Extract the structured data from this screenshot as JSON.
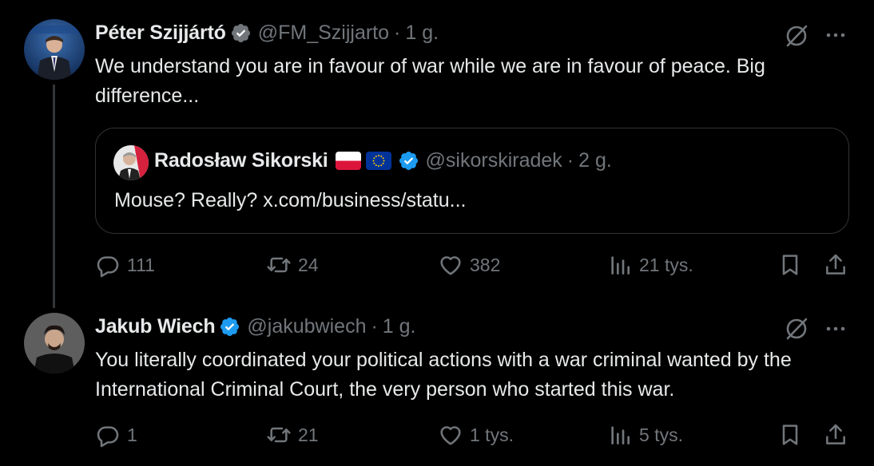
{
  "tweets": [
    {
      "name": "Péter Szijjártó",
      "handle": "@FM_Szijjarto",
      "separator": "·",
      "time": "1 g.",
      "text": "We understand you are in favour of war while we are in favour of peace. Big difference...",
      "quote": {
        "name": "Radosław Sikorski",
        "handle": "@sikorskiradek",
        "separator": "·",
        "time": "2 g.",
        "text": "Mouse?  Really? x.com/business/statu..."
      },
      "actions": {
        "replies": "111",
        "reposts": "24",
        "likes": "382",
        "views": "21 tys."
      }
    },
    {
      "name": "Jakub Wiech",
      "handle": "@jakubwiech",
      "separator": "·",
      "time": "1 g.",
      "text": "You literally coordinated your political actions with a war criminal wanted by the International Criminal Court, the very person who started this war.",
      "actions": {
        "replies": "1",
        "reposts": "21",
        "likes": "1 tys.",
        "views": "5 tys."
      }
    }
  ],
  "colors": {
    "background": "#000000",
    "text": "#e7e9ea",
    "muted": "#71767b",
    "verified": "#1d9bf0",
    "border": "#2f3336"
  },
  "icons": [
    "verified-badge-icon",
    "grok-icon",
    "more-icon",
    "reply-icon",
    "repost-icon",
    "like-icon",
    "views-icon",
    "bookmark-icon",
    "share-icon",
    "poland-flag-icon",
    "eu-flag-icon"
  ]
}
